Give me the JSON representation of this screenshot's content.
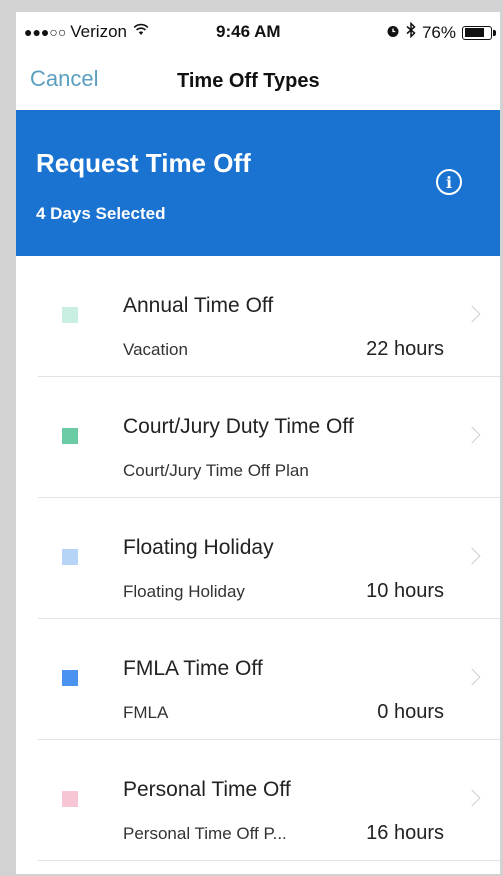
{
  "status_bar": {
    "signal_dots": "●●●○○",
    "carrier": "Verizon",
    "wifi_icon": "wifi-icon",
    "time": "9:46 AM",
    "alarm_icon": "alarm-icon",
    "bluetooth_icon": "bluetooth-icon",
    "battery_percent": "76%",
    "battery_level": 0.76
  },
  "nav": {
    "cancel_label": "Cancel",
    "title": "Time Off Types"
  },
  "header": {
    "title": "Request Time Off",
    "subtitle": "4 Days Selected",
    "info_icon": "info-icon",
    "background_color": "#1a73d1"
  },
  "time_off_types": [
    {
      "title": "Annual Time Off",
      "subtitle": "Vacation",
      "hours": "22 hours",
      "color": "#c8efe2"
    },
    {
      "title": "Court/Jury Duty Time Off",
      "subtitle": "Court/Jury Time Off Plan",
      "hours": "",
      "color": "#6bcba5"
    },
    {
      "title": "Floating Holiday",
      "subtitle": "Floating Holiday",
      "hours": "10 hours",
      "color": "#b6d4f6"
    },
    {
      "title": "FMLA Time Off",
      "subtitle": "FMLA",
      "hours": "0 hours",
      "color": "#4a93f0"
    },
    {
      "title": "Personal Time Off",
      "subtitle": "Personal Time Off P...",
      "hours": "16 hours",
      "color": "#f7c6d4"
    }
  ]
}
